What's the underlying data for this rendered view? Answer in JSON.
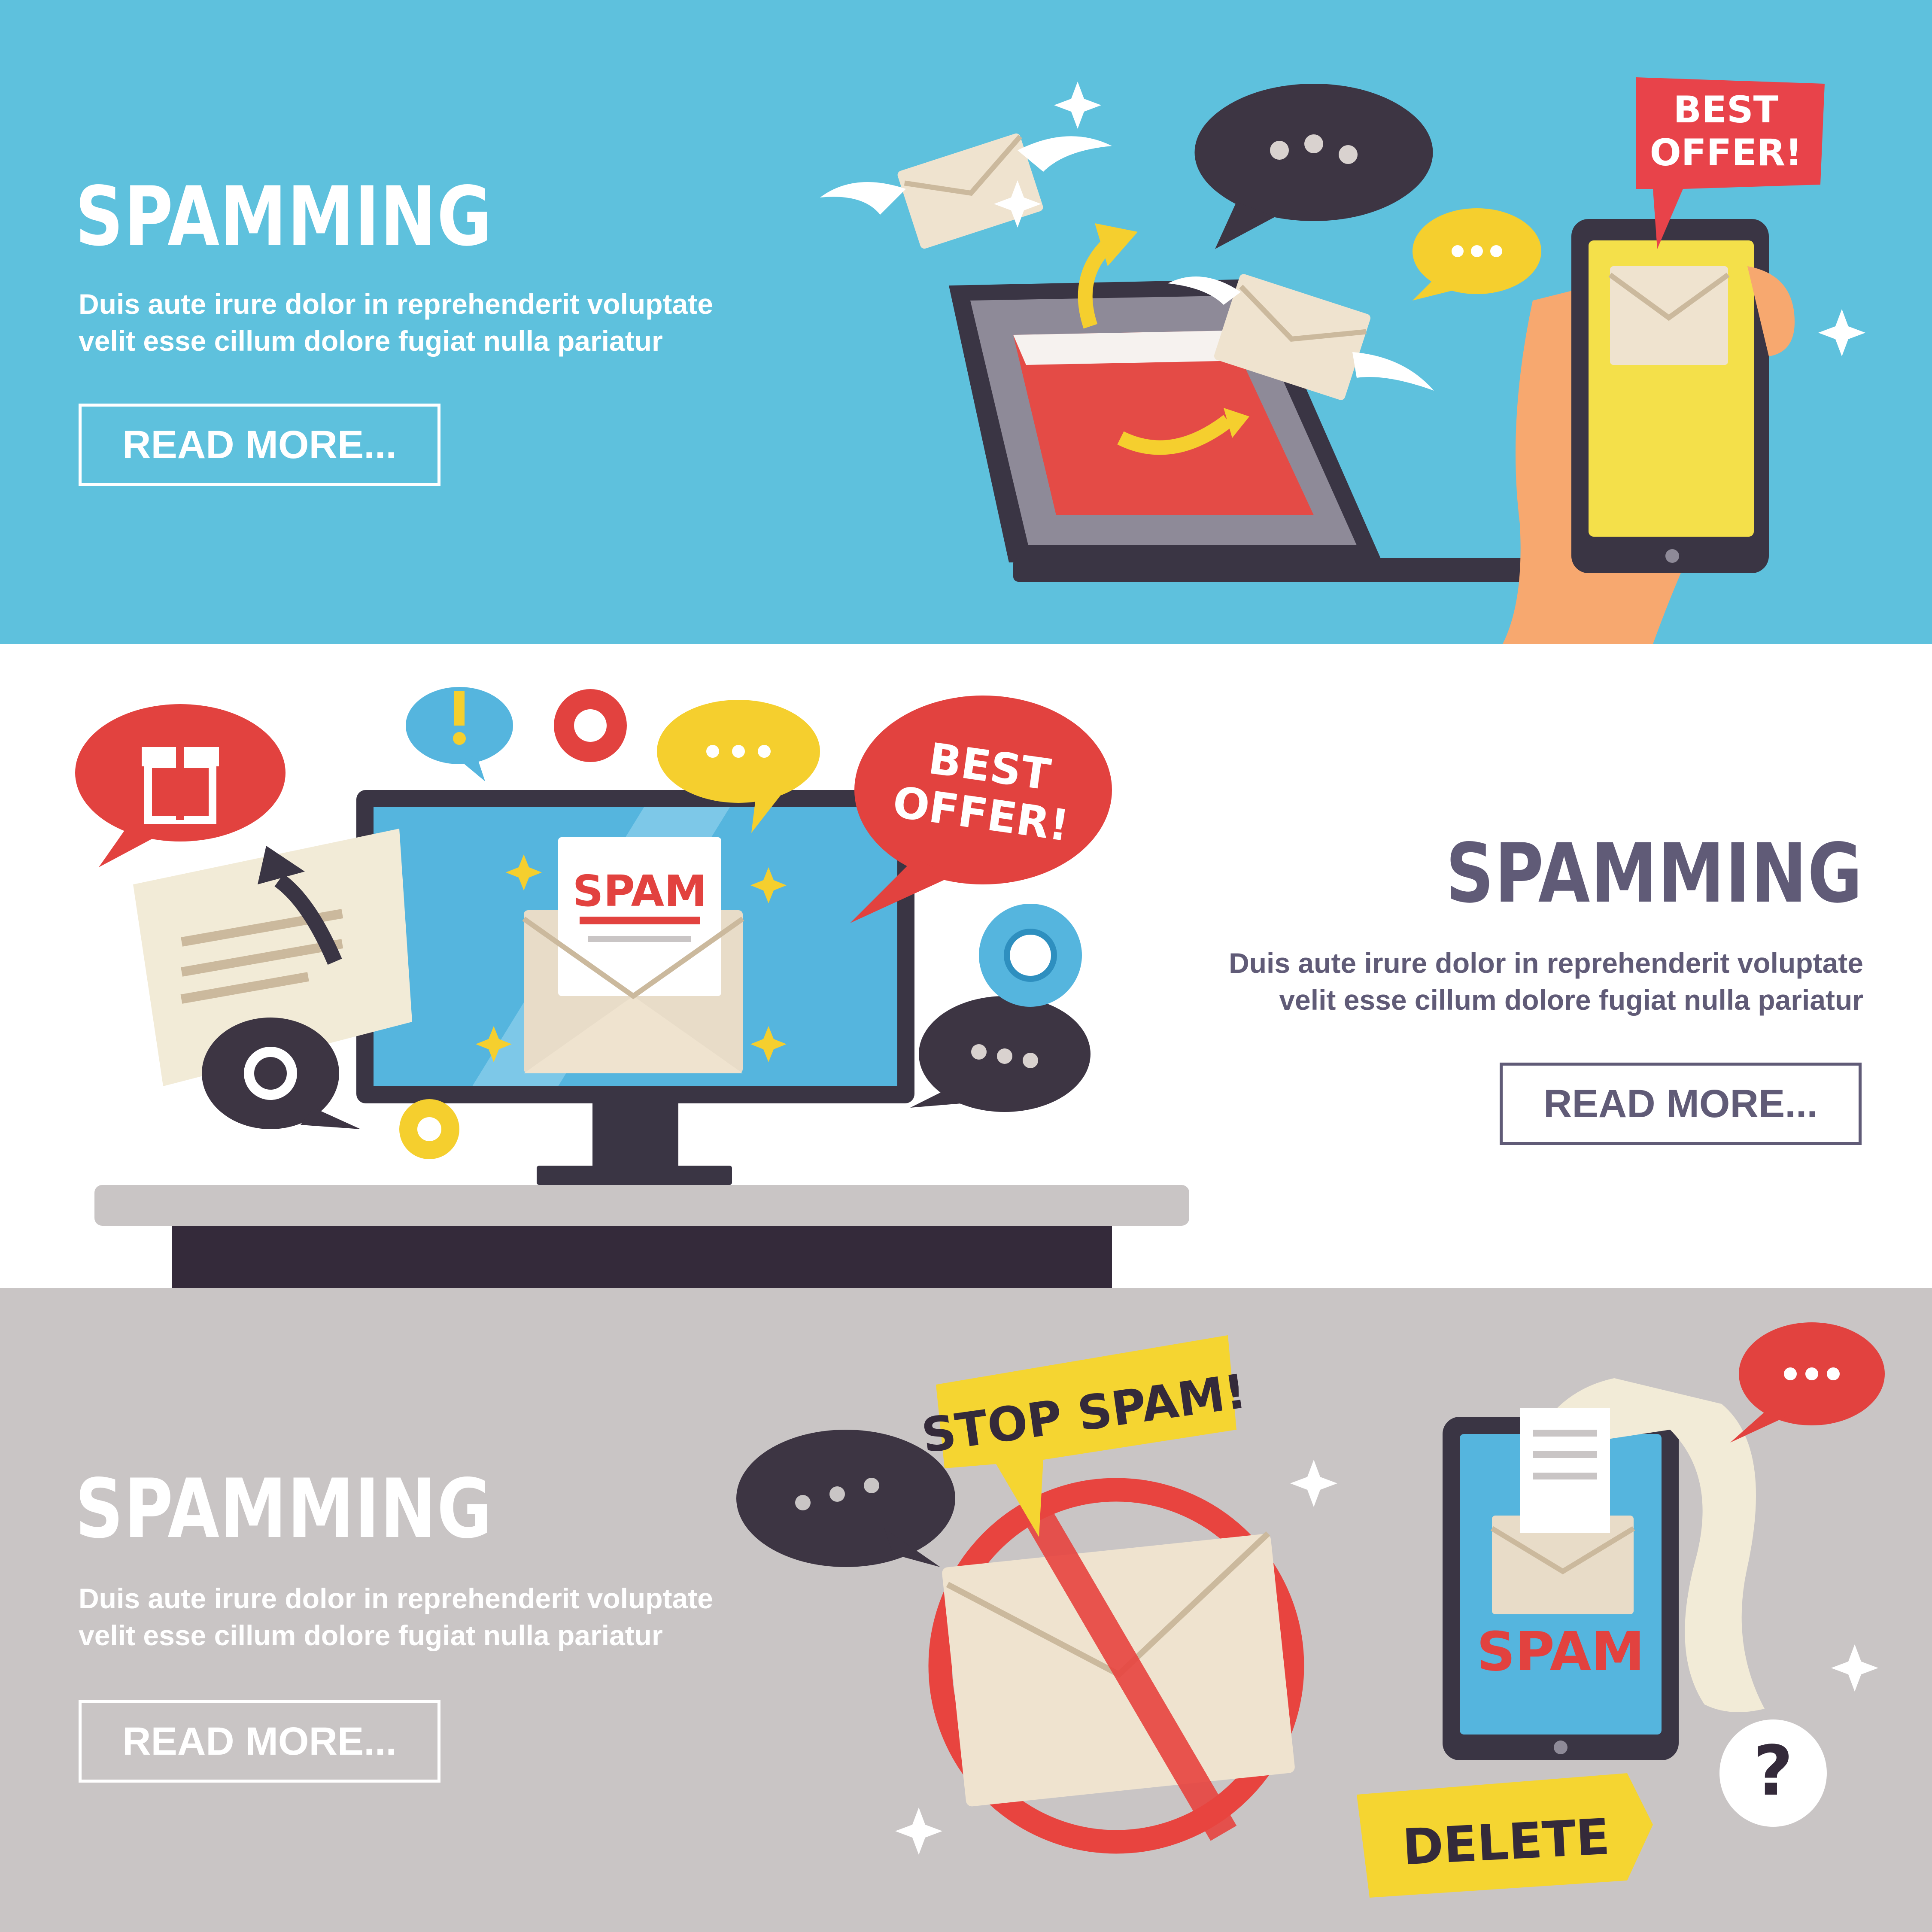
{
  "banners": [
    {
      "title": "SPAMMING",
      "description_line1": "Duis aute irure dolor in reprehenderit voluptate",
      "description_line2": "velit esse cillum dolore fugiat nulla pariatur",
      "button_label": "READ MORE...",
      "background": "#5ec1dd",
      "bubble_label_line1": "BEST",
      "bubble_label_line2": "OFFER!"
    },
    {
      "title": "SPAMMING",
      "description_line1": "Duis aute irure dolor in reprehenderit voluptate",
      "description_line2": "velit esse cillum dolore fugiat nulla pariatur",
      "button_label": "READ MORE...",
      "background": "#ffffff",
      "bubble_label_line1": "BEST",
      "bubble_label_line2": "OFFER!",
      "letter_label": "SPAM"
    },
    {
      "title": "SPAMMING",
      "description_line1": "Duis aute irure dolor in reprehenderit voluptate",
      "description_line2": "velit esse cillum dolore fugiat nulla pariatur",
      "button_label": "READ MORE...",
      "background": "#c9c5c5",
      "stop_label": "STOP SPAM!",
      "phone_label": "SPAM",
      "delete_label": "DELETE",
      "question_mark": "?"
    }
  ]
}
